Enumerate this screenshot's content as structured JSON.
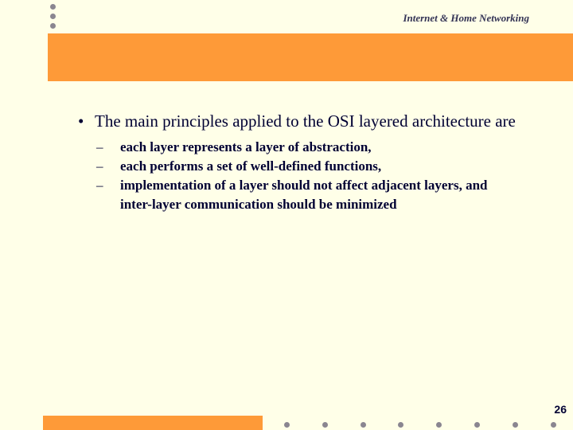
{
  "header": {
    "title": "Internet & Home Networking"
  },
  "content": {
    "bullet": {
      "marker": "•",
      "text": "The main principles applied to the OSI layered architecture are",
      "sub_items": [
        {
          "marker": "–",
          "text": "each layer represents a layer of abstraction,"
        },
        {
          "marker": "–",
          "text": "each performs a set of well-defined functions,"
        },
        {
          "marker": "–",
          "text": "implementation of a layer should not affect adjacent layers, and inter-layer communication should be minimized"
        }
      ]
    }
  },
  "footer": {
    "page_number": "26"
  },
  "colors": {
    "background": "#ffffe8",
    "accent": "#fe9a38",
    "dot": "#8a8690",
    "text": "#000033"
  }
}
